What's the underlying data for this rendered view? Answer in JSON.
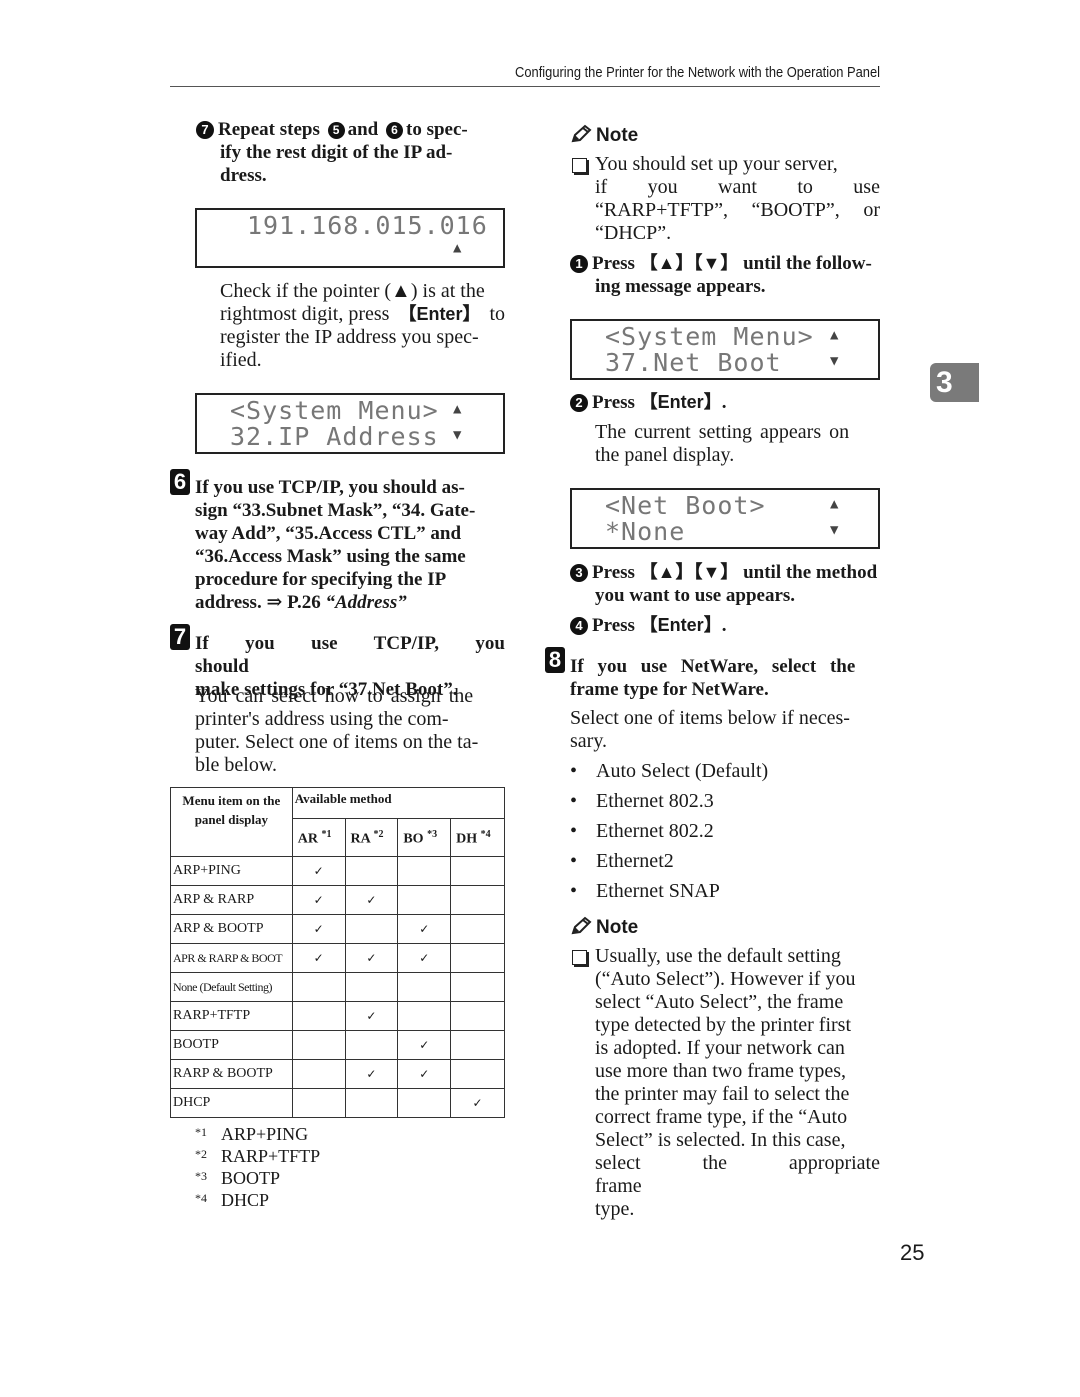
{
  "header": {
    "running_title": "Configuring the Printer for the Network with the Operation Panel"
  },
  "chapter_tab": "3",
  "page_number": "25",
  "left": {
    "substep7": {
      "marker": "7",
      "text_a": "Repeat steps",
      "ref1": "5",
      "text_b": "and",
      "ref2": "6",
      "text_c": "to spec-",
      "line2": "ify the rest digit of the IP ad-",
      "line3": "dress."
    },
    "lcd_ip": {
      "line1": "191.168.015.016",
      "pointer": "up-pointer"
    },
    "check_text": {
      "line1": "Check if the pointer (▲) is at the",
      "line2a": "rightmost digit, press",
      "key": "Enter",
      "line2b": "to",
      "line3": "register the IP address you spec-",
      "line4": "ified."
    },
    "lcd_menu": {
      "line1": "<System Menu>",
      "line2": "32.IP Address"
    },
    "step6": {
      "marker": "6",
      "lines": [
        "If you use TCP/IP, you should as-",
        "sign “33.Subnet Mask”, “34. Gate-",
        "way Add”, “35.Access CTL” and",
        "“36.Access Mask” using the same",
        "procedure for specifying the IP"
      ],
      "last_line": "address. ⇒ P.26",
      "last_ref": "“Address”"
    },
    "step7": {
      "marker": "7",
      "lines": [
        "If you use TCP/IP, you should",
        "make settings for “37.Net Boot”."
      ],
      "body": [
        "You can select how to assign the",
        "printer's address using the com-",
        "puter. Select one of items on the ta-",
        "ble below."
      ]
    },
    "table": {
      "header_col1": "Menu item on the panel display",
      "header_group": "Available method",
      "columns": [
        {
          "label": "AR",
          "note": "*1"
        },
        {
          "label": "RA",
          "note": "*2"
        },
        {
          "label": "BO",
          "note": "*3"
        },
        {
          "label": "DH",
          "note": "*4"
        }
      ],
      "check_glyph": "✓",
      "rows": [
        {
          "name": "ARP+PING",
          "checks": [
            "✓",
            "",
            "",
            ""
          ]
        },
        {
          "name": "ARP & RARP",
          "checks": [
            "✓",
            "✓",
            "",
            ""
          ]
        },
        {
          "name": "ARP & BOOTP",
          "checks": [
            "✓",
            "",
            "✓",
            ""
          ]
        },
        {
          "name": "APR & RARP & BOOT",
          "checks": [
            "✓",
            "✓",
            "✓",
            ""
          ]
        },
        {
          "name": "None (Default Setting)",
          "checks": [
            "",
            "",
            "",
            ""
          ]
        },
        {
          "name": "RARP+TFTP",
          "checks": [
            "",
            "✓",
            "",
            ""
          ]
        },
        {
          "name": "BOOTP",
          "checks": [
            "",
            "",
            "✓",
            ""
          ]
        },
        {
          "name": "RARP & BOOTP",
          "checks": [
            "",
            "✓",
            "✓",
            ""
          ]
        },
        {
          "name": "DHCP",
          "checks": [
            "",
            "",
            "",
            "✓"
          ]
        }
      ]
    },
    "footnotes": [
      {
        "mark": "*1",
        "text": "ARP+PING"
      },
      {
        "mark": "*2",
        "text": "RARP+TFTP"
      },
      {
        "mark": "*3",
        "text": "BOOTP"
      },
      {
        "mark": "*4",
        "text": "DHCP"
      }
    ]
  },
  "right": {
    "note1": {
      "heading": "Note",
      "lines": [
        "You should set up your server,",
        "if you want to use",
        "“RARP+TFTP”, “BOOTP”, or",
        "“DHCP”."
      ]
    },
    "sub1": {
      "marker": "1",
      "a": "Press",
      "k1": "▲",
      "k2": "▼",
      "b": "until the follow-",
      "line2": "ing message appears."
    },
    "lcd_netboot_menu": {
      "line1": "<System Menu>",
      "line2": "37.Net Boot"
    },
    "sub2": {
      "marker": "2",
      "a": "Press",
      "key": "Enter",
      "b": "."
    },
    "sub2_body": [
      "The current setting appears on",
      "the panel display."
    ],
    "lcd_netboot": {
      "line1": "<Net Boot>",
      "line2": "*None"
    },
    "sub3": {
      "marker": "3",
      "a": "Press",
      "k1": "▲",
      "k2": "▼",
      "b": "until the method",
      "line2": "you want to use appears."
    },
    "sub4": {
      "marker": "4",
      "a": "Press",
      "key": "Enter",
      "b": "."
    },
    "step8": {
      "marker": "8",
      "lines": [
        "If you use NetWare, select the",
        "frame type for NetWare."
      ],
      "body": [
        "Select one of items below if neces-",
        "sary."
      ]
    },
    "frame_types": [
      "Auto Select (Default)",
      "Ethernet 802.3",
      "Ethernet 802.2",
      "Ethernet2",
      "Ethernet SNAP"
    ],
    "note2": {
      "heading": "Note",
      "lines": [
        "Usually, use the default setting",
        "(“Auto Select”). However if you",
        "select “Auto Select”, the frame",
        "type detected by the printer first",
        "is adopted. If your network can",
        "use more than two frame types,",
        "the printer may fail to select the",
        "correct frame type, if the “Auto",
        "Select” is selected. In this case,",
        "select the appropriate frame",
        "type."
      ]
    }
  }
}
